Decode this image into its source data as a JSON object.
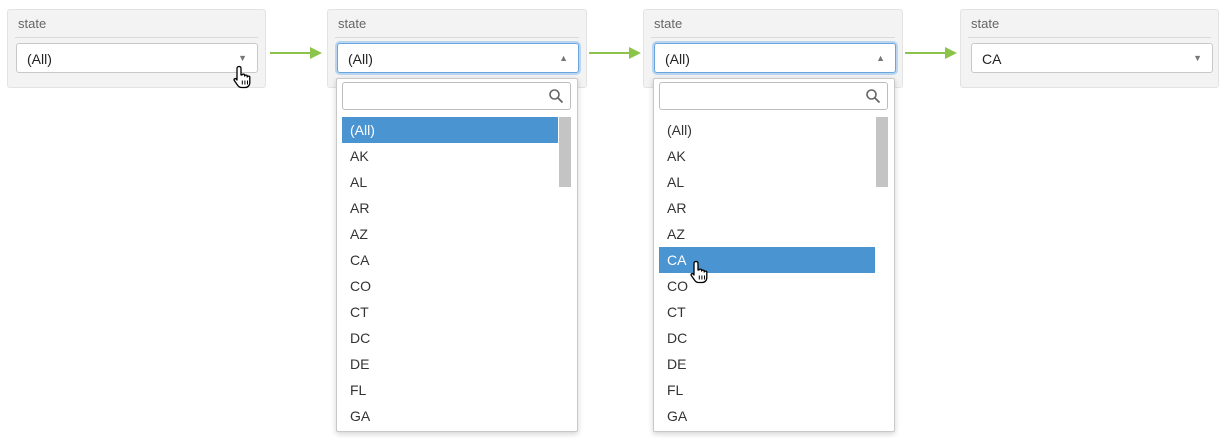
{
  "panels": [
    {
      "label": "state",
      "value": "(All)",
      "caret": "▼"
    },
    {
      "label": "state",
      "value": "(All)",
      "caret": "▲"
    },
    {
      "label": "state",
      "value": "(All)",
      "caret": "▲"
    },
    {
      "label": "state",
      "value": "CA",
      "caret": "▼"
    }
  ],
  "dropdowns": [
    {
      "search_value": "",
      "selected_option": "(All)",
      "options": [
        "(All)",
        "AK",
        "AL",
        "AR",
        "AZ",
        "CA",
        "CO",
        "CT",
        "DC",
        "DE",
        "FL",
        "GA"
      ]
    },
    {
      "search_value": "",
      "selected_option": "CA",
      "options": [
        "(All)",
        "AK",
        "AL",
        "AR",
        "AZ",
        "CA",
        "CO",
        "CT",
        "DC",
        "DE",
        "FL",
        "GA"
      ]
    }
  ],
  "colors": {
    "arrow": "#8cc34a",
    "selection": "#4a95d1",
    "focus_border": "#6aa6dd"
  },
  "icons": {
    "search": "search-icon",
    "pointer": "hand-pointer-cursor-icon",
    "flow_arrow": "right-arrow-icon"
  }
}
